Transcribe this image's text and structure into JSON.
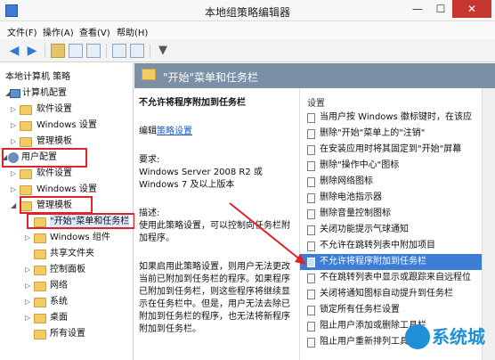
{
  "window": {
    "title": "本地组策略编辑器",
    "min": "—",
    "max": "☐",
    "close": "✕"
  },
  "menu": [
    "文件(F)",
    "操作(A)",
    "查看(V)",
    "帮助(H)"
  ],
  "toolbar": {
    "back": "◀",
    "forward": "▶",
    "filter": "▼"
  },
  "tree": {
    "root": "本地计算机 策略",
    "computer_config": "计算机配置",
    "computer_children": [
      "软件设置",
      "Windows 设置",
      "管理模板"
    ],
    "user_config": "用户配置",
    "user_children": [
      "软件设置",
      "Windows 设置",
      "管理模板"
    ],
    "admin_children": [
      "\"开始\"菜单和任务栏",
      "Windows 组件",
      "共享文件夹",
      "控制面板",
      "网络",
      "系统",
      "桌面",
      "所有设置"
    ]
  },
  "header": {
    "title": "\"开始\"菜单和任务栏"
  },
  "description": {
    "policy_title": "不允许将程序附加到任务栏",
    "edit_prefix": "编辑",
    "edit_link": "策略设置",
    "requirements_label": "要求:",
    "requirements_text": "Windows Server 2008 R2 或 Windows 7 及以上版本",
    "desc_label": "描述:",
    "desc_text": "使用此策略设置，可以控制向任务栏附加程序。",
    "desc_more": "如果启用此策略设置，则用户无法更改当前已附加到任务栏的程序。如果程序已附加到任务栏，则这些程序将继续显示在任务栏中。但是，用户无法去除已附加到任务栏的程序，也无法将新程序附加到任务栏。"
  },
  "list": {
    "header": "设置",
    "items": [
      "当用户按 Windows 徽标键时，在该应",
      "删除\"开始\"菜单上的\"注销\"",
      "在安装应用时将其固定到\"开始\"屏幕",
      "删除\"操作中心\"图标",
      "删除网络图标",
      "删除电池指示器",
      "删除音量控制图标",
      "关闭功能提示气球通知",
      "不允许在跳转列表中附加项目",
      "不允许将程序附加到任务栏",
      "不在跳转列表中显示或跟踪来自远程位",
      "关闭将通知图标自动提升到任务栏",
      "锁定所有任务栏设置",
      "阻止用户添加或删除工具栏",
      "阻止用户重新排列工具栏"
    ],
    "selected_index": 9
  },
  "watermark": {
    "text": "系统城"
  },
  "colors": {
    "selection": "#3d7dd6",
    "header": "#7b8fa6",
    "highlight_box": "#e0232b",
    "link": "#1a5bbf"
  }
}
